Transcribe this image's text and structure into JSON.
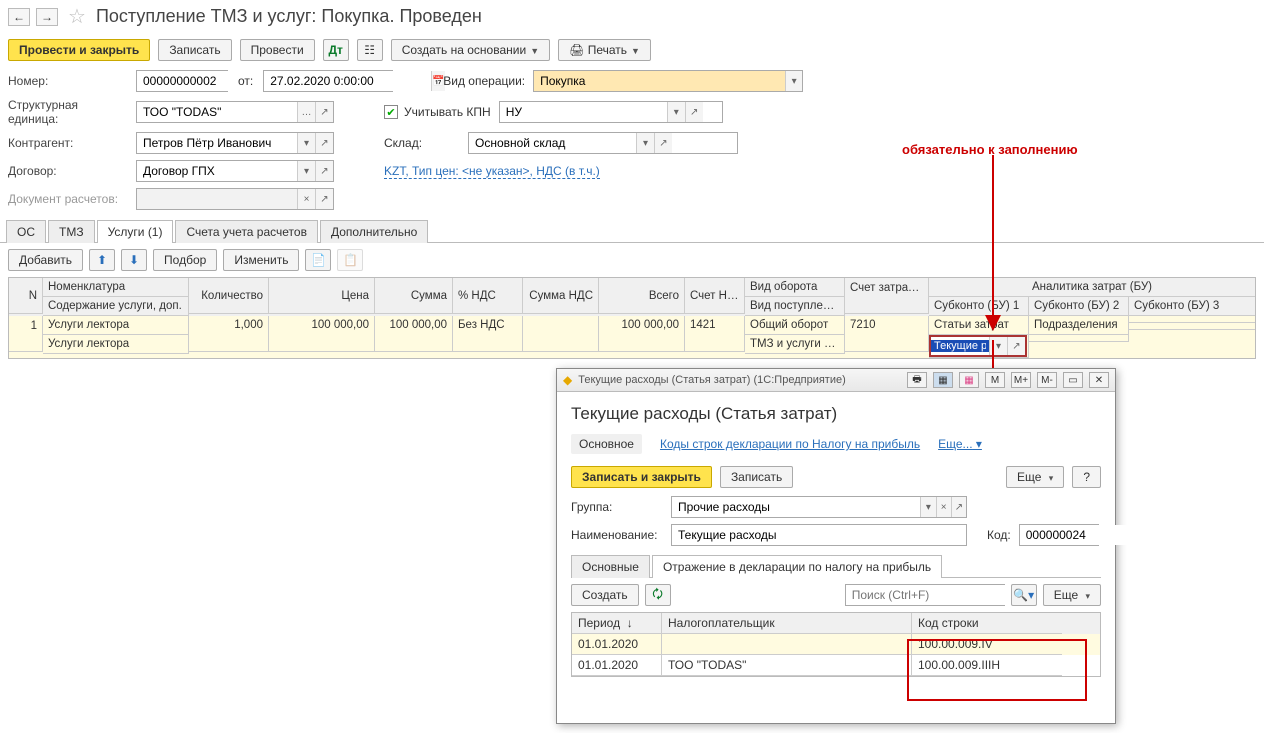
{
  "header": {
    "title": "Поступление ТМЗ и услуг: Покупка. Проведен"
  },
  "toolbar": {
    "post_close": "Провести и закрыть",
    "save": "Записать",
    "post": "Провести",
    "create_based": "Создать на основании",
    "print": "Печать"
  },
  "form": {
    "number_label": "Номер:",
    "number": "00000000002",
    "from_label": "от:",
    "date": "27.02.2020 0:00:00",
    "op_label": "Вид операции:",
    "op_value": "Покупка",
    "org_label": "Структурная единица:",
    "org_value": "ТОО \"TODAS\"",
    "kpn_label": "Учитывать КПН",
    "kpn_select": "НУ",
    "contr_label": "Контрагент:",
    "contr_value": "Петров Пётр Иванович",
    "sklad_label": "Склад:",
    "sklad_value": "Основной склад",
    "dog_label": "Договор:",
    "dog_value": "Договор ГПХ",
    "price_link": "KZT, Тип цен: <не указан>, НДС (в т.ч.)",
    "docr_label": "Документ расчетов:"
  },
  "tabs": [
    "ОС",
    "ТМЗ",
    "Услуги (1)",
    "Счета учета расчетов",
    "Дополнительно"
  ],
  "active_tab": 2,
  "tbl_toolbar": {
    "add": "Добавить",
    "pick": "Подбор",
    "edit": "Изменить"
  },
  "grid": {
    "headers": {
      "n": "N",
      "nom": "Номенклатура",
      "nom2": "Содержание услуги, доп.",
      "qty": "Количество",
      "price": "Цена",
      "sum": "Сумма",
      "nds": "% НДС",
      "sumnds": "Сумма НДС",
      "total": "Всего",
      "acctnds": "Счет НДС",
      "turn": "Вид оборота",
      "turn2": "Вид поступления",
      "acct": "Счет затрат (БУ)",
      "analytics": "Аналитика затрат (БУ)",
      "sub1": "Субконто (БУ) 1",
      "sub2": "Субконто (БУ) 2",
      "sub3": "Субконто (БУ) 3"
    },
    "row": {
      "n": "1",
      "nom": "Услуги лектора",
      "nom2": "Услуги лектора",
      "qty": "1,000",
      "price": "100 000,00",
      "sum": "100 000,00",
      "nds": "Без НДС",
      "sumnds": "",
      "total": "100 000,00",
      "acctnds": "1421",
      "turn": "Общий оборот",
      "turn2": "ТМЗ и услуги бе...",
      "acct": "7210",
      "sub1_top": "Статьи затрат",
      "sub1_val": "Текущие р",
      "sub2_top": "Подразделения"
    }
  },
  "annotation": "обязательно к заполнению",
  "modal": {
    "titlebar": "Текущие расходы (Статья затрат)   (1С:Предприятие)",
    "mem_btns": [
      "M",
      "M+",
      "M-"
    ],
    "h1": "Текущие расходы (Статья затрат)",
    "nav_main": "Основное",
    "nav_link": "Коды строк декларации по Налогу на прибыль",
    "nav_more": "Еще...",
    "save_close": "Записать и закрыть",
    "save": "Записать",
    "more": "Еще",
    "help": "?",
    "group_label": "Группа:",
    "group_value": "Прочие расходы",
    "name_label": "Наименование:",
    "name_value": "Текущие расходы",
    "code_label": "Код:",
    "code_value": "000000024",
    "tabs": [
      "Основные",
      "Отражение в декларации по налогу на прибыль"
    ],
    "create": "Создать",
    "search_ph": "Поиск (Ctrl+F)",
    "t_head": {
      "period": "Период",
      "tax": "Налогоплательщик",
      "code": "Код строки",
      "arrow": "↓"
    },
    "rows": [
      {
        "period": "01.01.2020",
        "tax": "",
        "code": "100.00.009.IV"
      },
      {
        "period": "01.01.2020",
        "tax": "ТОО \"TODAS\"",
        "code": "100.00.009.IIIH"
      }
    ]
  }
}
